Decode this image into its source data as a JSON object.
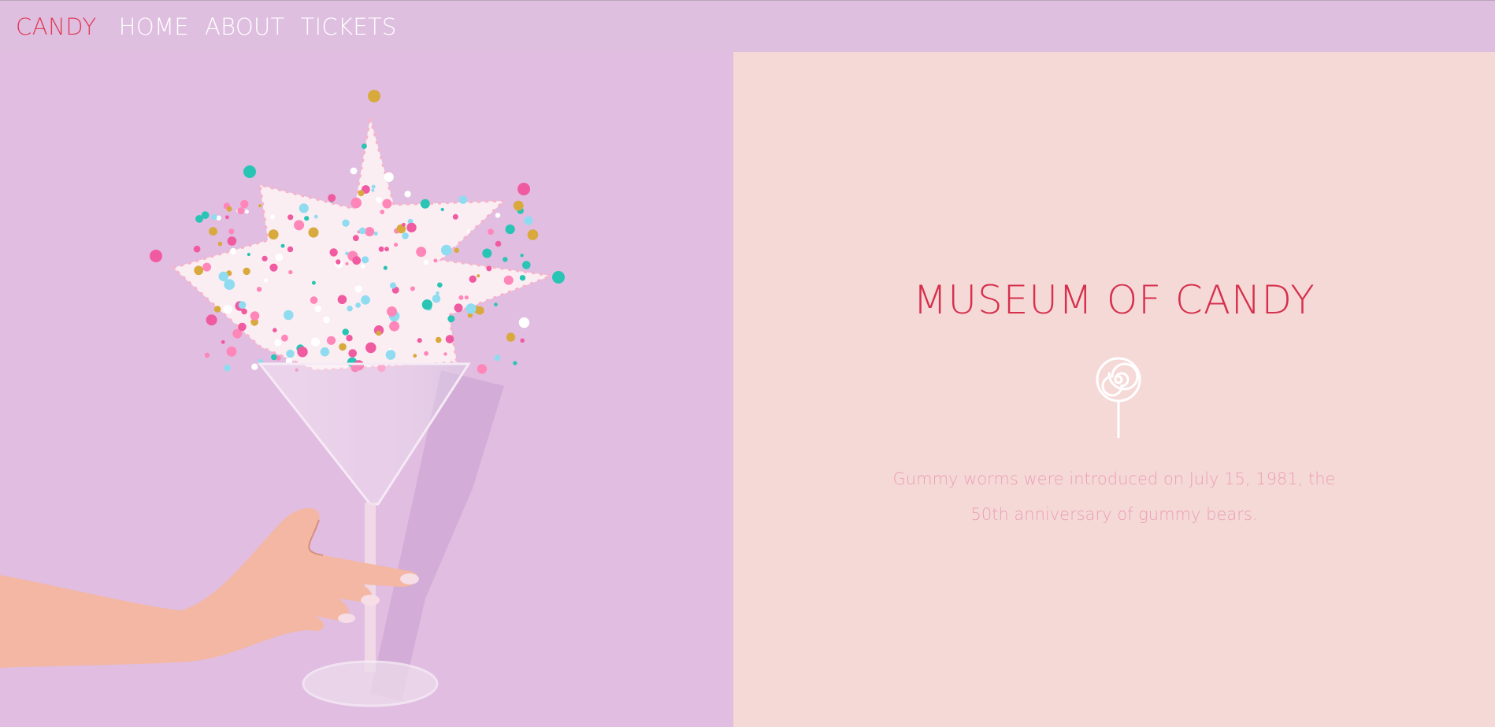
{
  "nav": {
    "brand": "CANDY",
    "links": [
      {
        "label": "HOME"
      },
      {
        "label": "ABOUT"
      },
      {
        "label": "TICKETS"
      }
    ]
  },
  "hero": {
    "image": "hand-holding-martini-glass-with-sprinkles"
  },
  "main": {
    "title": "MUSEUM OF CANDY",
    "icon": "lollipop-icon",
    "fact": "Gummy worms were introduced on July 15, 1981, the 50th anniversary of gummy bears."
  },
  "colors": {
    "nav_background": "#dfbfdf",
    "brand": "#e03c5a",
    "nav_link": "#ffffff",
    "hero_background": "#e1bde1",
    "content_background": "#f5d9d7",
    "title": "#d6304c",
    "fact_text": "#eb9fb5"
  }
}
